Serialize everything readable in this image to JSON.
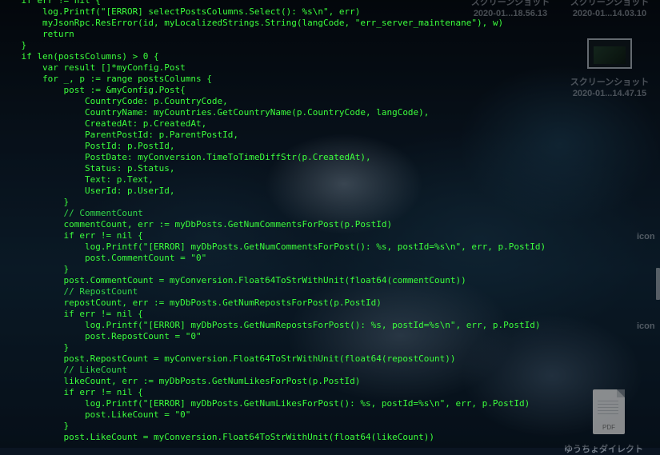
{
  "terminal": {
    "lines": [
      {
        "text": "    if err != nil {",
        "type": "code"
      },
      {
        "text": "        log.Printf(\"[ERROR] selectPostsColumns.Select(): %s\\n\", err)",
        "type": "code"
      },
      {
        "text": "        myJsonRpc.ResError(id, myLocalizedStrings.String(langCode, \"err_server_maintenane\"), w)",
        "type": "code"
      },
      {
        "text": "        return",
        "type": "code"
      },
      {
        "text": "    }",
        "type": "code"
      },
      {
        "text": "    if len(postsColumns) > 0 {",
        "type": "code"
      },
      {
        "text": "        var result []*myConfig.Post",
        "type": "code"
      },
      {
        "text": "        for _, p := range postsColumns {",
        "type": "code"
      },
      {
        "text": "            post := &myConfig.Post{",
        "type": "code"
      },
      {
        "text": "                CountryCode: p.CountryCode,",
        "type": "code"
      },
      {
        "text": "                CountryName: myCountries.GetCountryName(p.CountryCode, langCode),",
        "type": "code"
      },
      {
        "text": "                CreatedAt: p.CreatedAt,",
        "type": "code"
      },
      {
        "text": "                ParentPostId: p.ParentPostId,",
        "type": "code"
      },
      {
        "text": "                PostId: p.PostId,",
        "type": "code"
      },
      {
        "text": "                PostDate: myConversion.TimeToTimeDiffStr(p.CreatedAt),",
        "type": "code"
      },
      {
        "text": "                Status: p.Status,",
        "type": "code"
      },
      {
        "text": "                Text: p.Text,",
        "type": "code"
      },
      {
        "text": "                UserId: p.UserId,",
        "type": "code"
      },
      {
        "text": "            }",
        "type": "code"
      },
      {
        "text": "            // CommentCount",
        "type": "comment"
      },
      {
        "text": "            commentCount, err := myDbPosts.GetNumCommentsForPost(p.PostId)",
        "type": "code"
      },
      {
        "text": "            if err != nil {",
        "type": "code"
      },
      {
        "text": "                log.Printf(\"[ERROR] myDbPosts.GetNumCommentsForPost(): %s, postId=%s\\n\", err, p.PostId)",
        "type": "code"
      },
      {
        "text": "                post.CommentCount = \"0\"",
        "type": "code"
      },
      {
        "text": "            }",
        "type": "code"
      },
      {
        "text": "            post.CommentCount = myConversion.Float64ToStrWithUnit(float64(commentCount))",
        "type": "code"
      },
      {
        "text": "            // RepostCount",
        "type": "comment"
      },
      {
        "text": "            repostCount, err := myDbPosts.GetNumRepostsForPost(p.PostId)",
        "type": "code"
      },
      {
        "text": "            if err != nil {",
        "type": "code"
      },
      {
        "text": "                log.Printf(\"[ERROR] myDbPosts.GetNumRepostsForPost(): %s, postId=%s\\n\", err, p.PostId)",
        "type": "code"
      },
      {
        "text": "                post.RepostCount = \"0\"",
        "type": "code"
      },
      {
        "text": "            }",
        "type": "code"
      },
      {
        "text": "            post.RepostCount = myConversion.Float64ToStrWithUnit(float64(repostCount))",
        "type": "code"
      },
      {
        "text": "            // LikeCount",
        "type": "comment"
      },
      {
        "text": "            likeCount, err := myDbPosts.GetNumLikesForPost(p.PostId)",
        "type": "code"
      },
      {
        "text": "            if err != nil {",
        "type": "code"
      },
      {
        "text": "                log.Printf(\"[ERROR] myDbPosts.GetNumLikesForPost(): %s, postId=%s\\n\", err, p.PostId)",
        "type": "code"
      },
      {
        "text": "                post.LikeCount = \"0\"",
        "type": "code"
      },
      {
        "text": "            }",
        "type": "code"
      },
      {
        "text": "            post.LikeCount = myConversion.Float64ToStrWithUnit(float64(likeCount))",
        "type": "code"
      }
    ],
    "code_color": "#3cff3c",
    "comment_color": "#33d94a"
  },
  "desktop": {
    "screenshot_1": {
      "title": "スクリーンショット",
      "date": "2020-01...18.56.13"
    },
    "screenshot_2": {
      "title": "スクリーンショット",
      "date": "2020-01...14.03.10"
    },
    "screenshot_3": {
      "title": "スクリーンショット",
      "date": "2020-01...14.47.15",
      "icon": "image-thumbnail-icon"
    },
    "edge_label_1": "icon",
    "edge_label_2": "icon",
    "pdf_file": {
      "badge": "PDF",
      "icon": "pdf-file-icon"
    },
    "bottom_label": "ゆうちょダイレクト"
  }
}
